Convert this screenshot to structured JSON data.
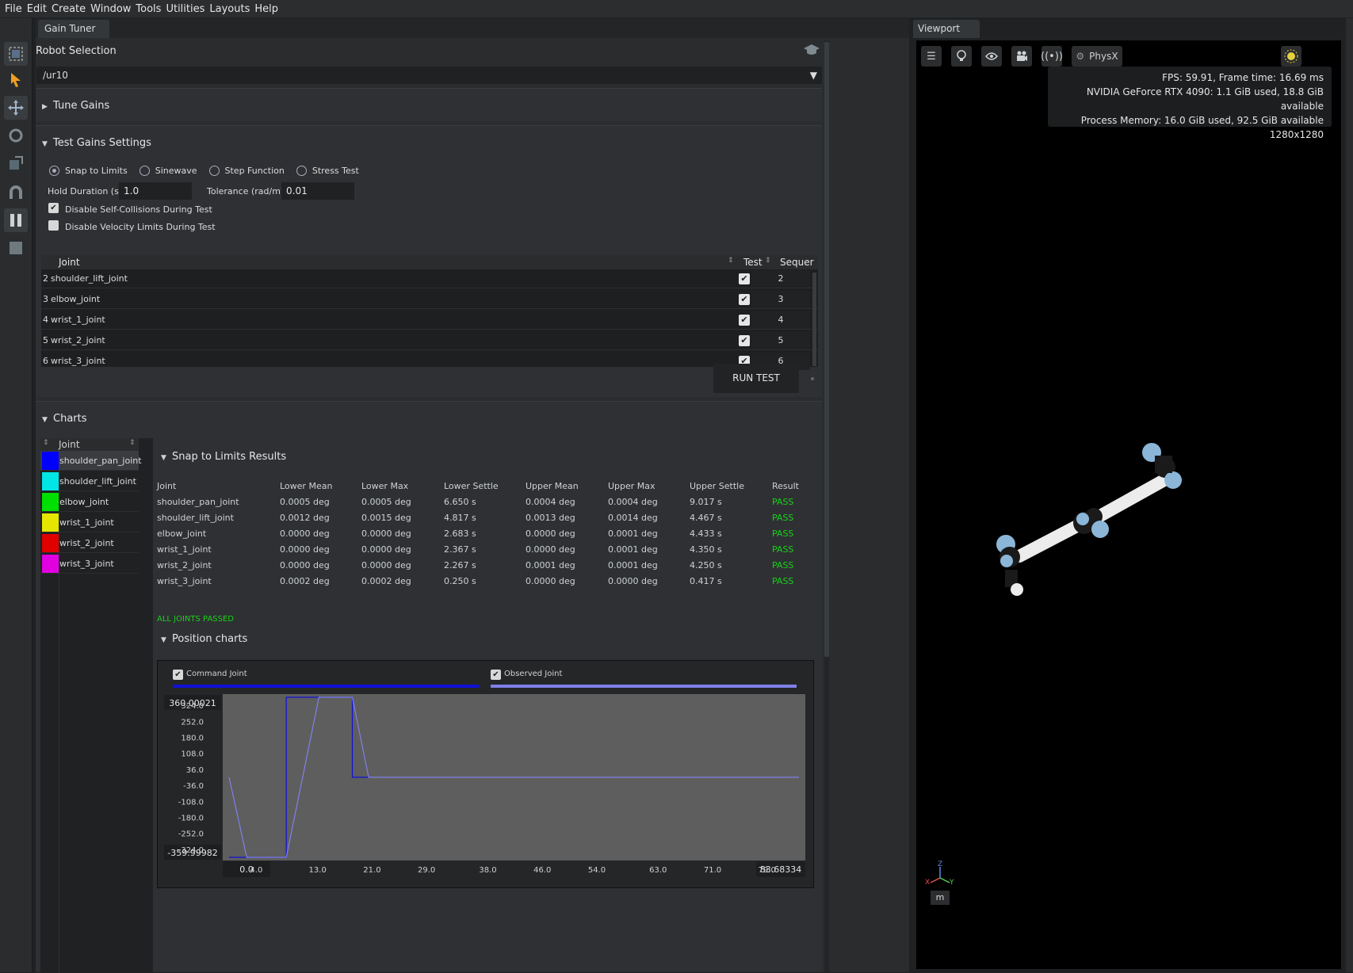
{
  "menu": [
    "File",
    "Edit",
    "Create",
    "Window",
    "Tools",
    "Utilities",
    "Layouts",
    "Help"
  ],
  "panel": {
    "tab": "Gain Tuner",
    "robot_selection": {
      "title": "Robot Selection",
      "value": "/ur10"
    },
    "tune_gains": {
      "title": "Tune Gains"
    },
    "test_settings": {
      "title": "Test Gains Settings",
      "modes": [
        "Snap to Limits",
        "Sinewave",
        "Step Function",
        "Stress Test"
      ],
      "selected_mode": "Snap to Limits",
      "hold_duration_label": "Hold Duration (s)",
      "hold_duration": "1.0",
      "tolerance_label": "Tolerance (rad/m)",
      "tolerance": "0.01",
      "disable_self_collisions": "Disable Self-Collisions During Test",
      "disable_velocity_limits": "Disable Velocity Limits During Test",
      "table_headers": {
        "joint": "Joint",
        "test": "Test",
        "sequence": "Sequer"
      },
      "rows": [
        {
          "num": "2",
          "name": "shoulder_lift_joint",
          "seq": "2"
        },
        {
          "num": "3",
          "name": "elbow_joint",
          "seq": "3"
        },
        {
          "num": "4",
          "name": "wrist_1_joint",
          "seq": "4"
        },
        {
          "num": "5",
          "name": "wrist_2_joint",
          "seq": "5"
        },
        {
          "num": "6",
          "name": "wrist_3_joint",
          "seq": "6"
        }
      ],
      "run_button": "RUN TEST"
    },
    "charts": {
      "title": "Charts",
      "legend_header": "Joint",
      "legend": [
        {
          "name": "shoulder_pan_joint",
          "color": "#0000ff"
        },
        {
          "name": "shoulder_lift_joint",
          "color": "#00e5e5"
        },
        {
          "name": "elbow_joint",
          "color": "#00e000"
        },
        {
          "name": "wrist_1_joint",
          "color": "#e5e500"
        },
        {
          "name": "wrist_2_joint",
          "color": "#e00000"
        },
        {
          "name": "wrist_3_joint",
          "color": "#e000e0"
        }
      ],
      "results_title": "Snap to Limits Results",
      "results_headers": [
        "Joint",
        "Lower Mean",
        "Lower Max",
        "Lower Settle",
        "Upper Mean",
        "Upper Max",
        "Upper Settle",
        "Result"
      ],
      "results": [
        [
          "shoulder_pan_joint",
          "0.0005 deg",
          "0.0005 deg",
          "6.650 s",
          "0.0004 deg",
          "0.0004 deg",
          "9.017 s",
          "PASS"
        ],
        [
          "shoulder_lift_joint",
          "0.0012 deg",
          "0.0015 deg",
          "4.817 s",
          "0.0013 deg",
          "0.0014 deg",
          "4.467 s",
          "PASS"
        ],
        [
          "elbow_joint",
          "0.0000 deg",
          "0.0000 deg",
          "2.683 s",
          "0.0000 deg",
          "0.0001 deg",
          "4.433 s",
          "PASS"
        ],
        [
          "wrist_1_joint",
          "0.0000 deg",
          "0.0000 deg",
          "2.367 s",
          "0.0000 deg",
          "0.0001 deg",
          "4.350 s",
          "PASS"
        ],
        [
          "wrist_2_joint",
          "0.0000 deg",
          "0.0000 deg",
          "2.267 s",
          "0.0001 deg",
          "0.0001 deg",
          "4.250 s",
          "PASS"
        ],
        [
          "wrist_3_joint",
          "0.0002 deg",
          "0.0002 deg",
          "0.250 s",
          "0.0000 deg",
          "0.0000 deg",
          "0.417 s",
          "PASS"
        ]
      ],
      "summary": "ALL JOINTS PASSED",
      "position_title": "Position charts",
      "legend_command": "Command Joint",
      "legend_observed": "Observed Joint"
    }
  },
  "chart_data": {
    "type": "line",
    "ylim": [
      -359.99982,
      360.00021
    ],
    "xlim": [
      0.0,
      83.68334
    ],
    "yticks": [
      "324.0",
      "252.0",
      "180.0",
      "108.0",
      "36.0",
      "-36.0",
      "-108.0",
      "-180.0",
      "-252.0",
      "-324.0"
    ],
    "ymax_label": "360.00021",
    "ymin_label": "-359.99982",
    "xticks": [
      "4.0",
      "13.0",
      "21.0",
      "29.0",
      "38.0",
      "46.0",
      "54.0",
      "63.0",
      "71.0",
      "79.0"
    ],
    "xmin_label": "0.0",
    "xmax_label": "83.68334",
    "series": [
      {
        "name": "Command Joint",
        "color": "#1010d8",
        "points": [
          [
            0.0,
            -360.0
          ],
          [
            8.4,
            -360.0
          ],
          [
            8.4,
            360.0
          ],
          [
            18.1,
            360.0
          ],
          [
            18.1,
            0.0
          ],
          [
            20.5,
            0.0
          ]
        ]
      },
      {
        "name": "Observed Joint",
        "color": "#8080e8",
        "points": [
          [
            0.0,
            0.0
          ],
          [
            2.6,
            -360.0
          ],
          [
            8.4,
            -360.0
          ],
          [
            13.2,
            360.0
          ],
          [
            18.1,
            360.0
          ],
          [
            20.5,
            0.0
          ],
          [
            83.68,
            0.0
          ]
        ]
      }
    ]
  },
  "viewport": {
    "tab": "Viewport",
    "physx": "PhysX",
    "stats": [
      "FPS: 59.91, Frame time: 16.69 ms",
      "NVIDIA GeForce RTX 4090: 1.1 GiB used, 18.8 GiB available",
      "Process Memory: 16.0 GiB used, 92.5 GiB available",
      "1280x1280"
    ],
    "units": "m"
  }
}
